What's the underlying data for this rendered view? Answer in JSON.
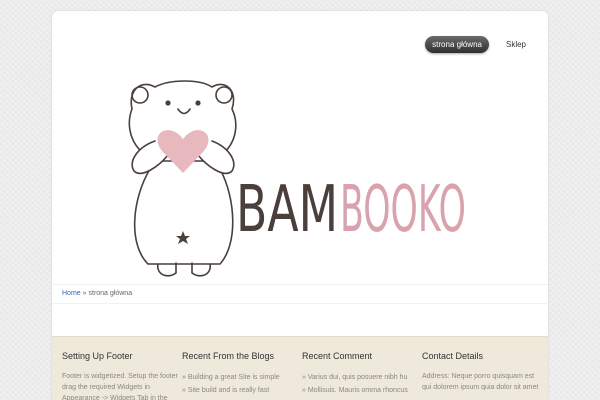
{
  "nav": {
    "items": [
      {
        "label": "strona główna",
        "active": true
      },
      {
        "label": "Sklep",
        "active": false
      }
    ]
  },
  "logo": {
    "part1": "BAM",
    "part2": "BOOKO",
    "color1": "#4a3f3a",
    "color2": "#d8a3ad",
    "icon": "bear-holding-heart-icon"
  },
  "breadcrumb": {
    "home": "Home",
    "sep": "»",
    "current": "strona główna"
  },
  "footer": {
    "col1": {
      "title": "Setting Up Footer",
      "text": "Footer is widgetized. Setup the footer drag the required Widgets in Appearance -> Widgets Tab in the"
    },
    "col2": {
      "title": "Recent From the Blogs",
      "items": [
        "Building a great Site is simple",
        "Site build and is really fast"
      ]
    },
    "col3": {
      "title": "Recent Comment",
      "items": [
        "Varius dui, quis posuere nibh hu",
        "Mollisuis. Mauris omma rhoncus"
      ]
    },
    "col4": {
      "title": "Contact Details",
      "text": "Address: Neque porro quisquam est qui dolorem ipsum quia dolor sit amet"
    }
  }
}
